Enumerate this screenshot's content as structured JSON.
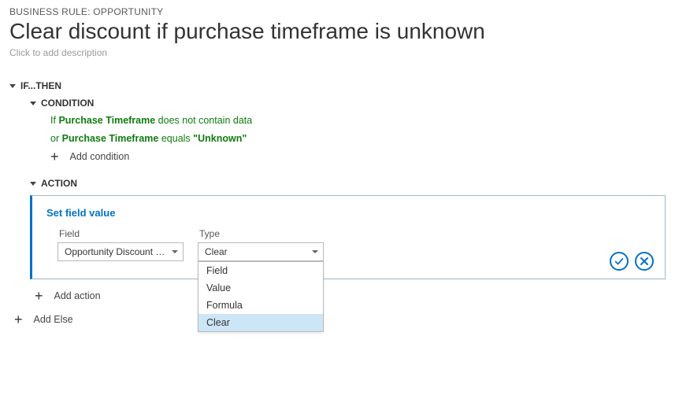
{
  "breadcrumb": "BUSINESS RULE: Opportunity",
  "title": "Clear discount if purchase timeframe is unknown",
  "description_placeholder": "Click to add description",
  "ifthen": {
    "label": "IF...THEN",
    "condition": {
      "label": "CONDITION",
      "lines": [
        {
          "kw": "If",
          "field": "Purchase Timeframe",
          "op": "does not contain data",
          "val": ""
        },
        {
          "kw": "or",
          "field": "Purchase Timeframe",
          "op": "equals",
          "val": "\"Unknown\""
        }
      ],
      "add_label": "Add condition"
    },
    "action": {
      "label": "ACTION",
      "card": {
        "title": "Set field value",
        "field_label": "Field",
        "field_value": "Opportunity Discount (%)",
        "type_label": "Type",
        "type_value": "Clear",
        "type_options": [
          "Field",
          "Value",
          "Formula",
          "Clear"
        ]
      },
      "add_label": "Add action"
    },
    "add_else_label": "Add Else"
  },
  "icons": {
    "confirm": "check-circle-icon",
    "cancel": "x-circle-icon"
  }
}
